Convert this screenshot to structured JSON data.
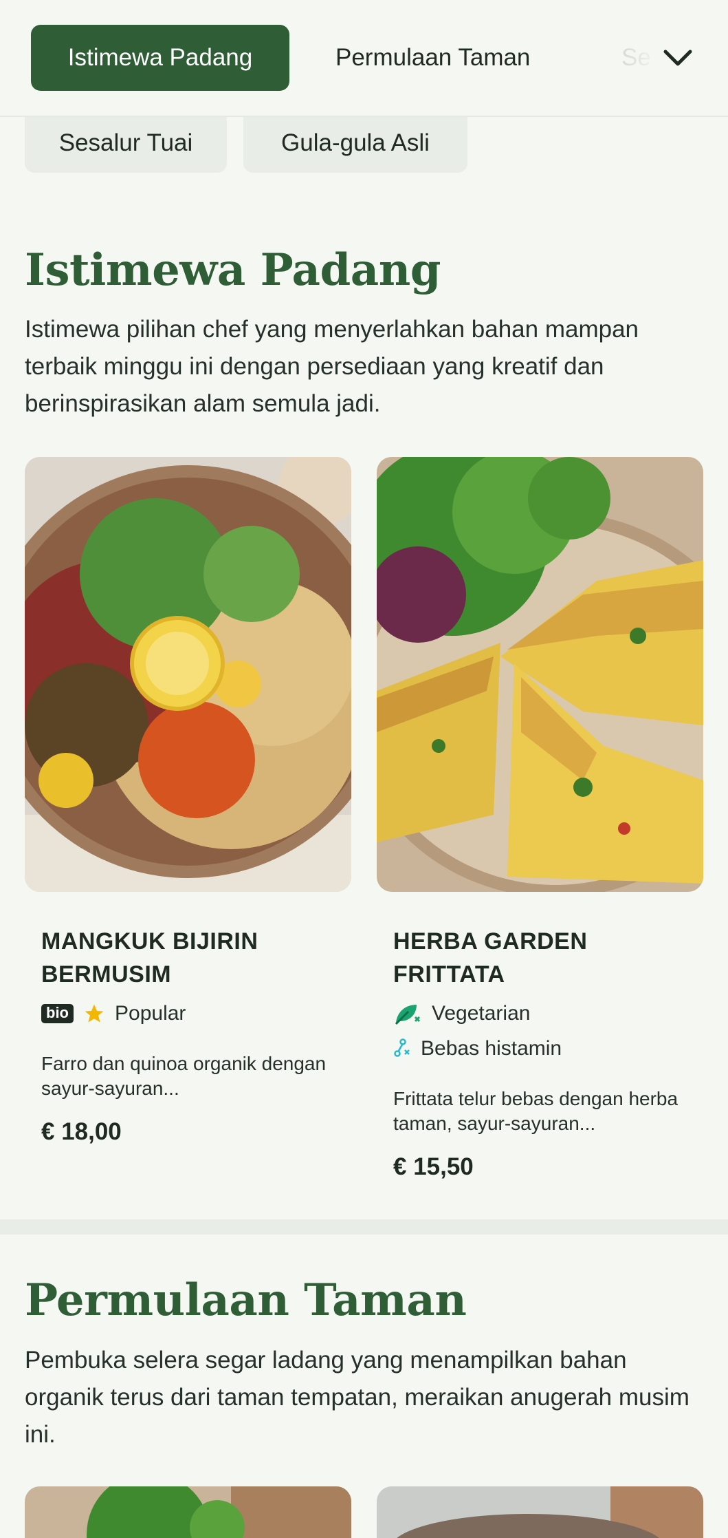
{
  "nav": {
    "tabs": [
      "Istimewa Padang",
      "Permulaan Taman",
      "Se"
    ],
    "chips": [
      "Sesalur Tuai",
      "Gula-gula Asli"
    ]
  },
  "sections": [
    {
      "title": "Istimewa Padang",
      "description": "Istimewa pilihan chef yang menyerlahkan bahan mampan terbaik minggu ini dengan persediaan yang kreatif dan berinspirasikan alam semula jadi.",
      "items": [
        {
          "name": "MANGKUK BIJIRIN BERMUSIM",
          "badge": "bio",
          "tag": "Popular",
          "description": "Farro dan quinoa organik dengan sayur-sayuran...",
          "price": "€ 18,00"
        },
        {
          "name": "HERBA GARDEN FRITTATA",
          "tags": [
            "Vegetarian",
            "Bebas histamin"
          ],
          "description": "Frittata telur bebas dengan herba taman, sayur-sayuran...",
          "price": "€ 15,50"
        }
      ]
    },
    {
      "title": "Permulaan Taman",
      "description": "Pembuka selera segar ladang yang menampilkan bahan organik terus dari taman tempatan, meraikan anugerah musim ini."
    }
  ],
  "colors": {
    "accent": "#2f5d36",
    "background": "#f4f7f2",
    "chip": "#e8ede7",
    "star": "#f2b705",
    "veg": "#1aa36e",
    "histamine": "#2ab8c8"
  },
  "icons": {
    "expand": "chevron-down-icon",
    "popular": "star-icon",
    "vegetarian": "leaf-icon",
    "histamine": "molecule-icon"
  }
}
